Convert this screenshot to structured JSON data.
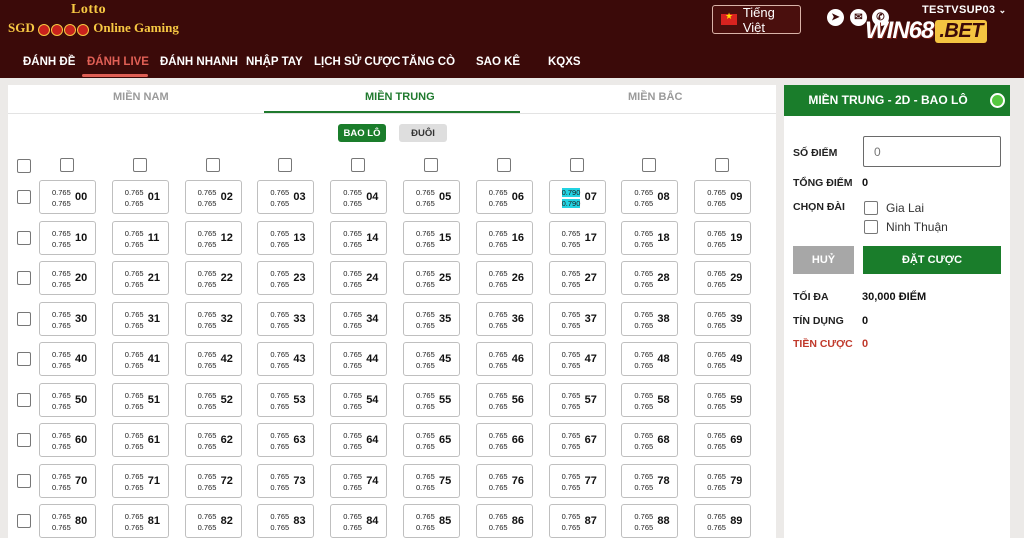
{
  "header": {
    "logo_top": "Lotto",
    "logo_prefix": "SGD",
    "logo_suffix": "Online Gaming",
    "language": "Tiếng Việt",
    "username": "TESTVSUP03",
    "brand_main": "WIN68",
    "brand_tld": ".BET",
    "icons": [
      "telegram-icon",
      "messenger-icon",
      "phone-icon"
    ]
  },
  "nav": {
    "items": [
      "ĐÁNH ĐỀ",
      "ĐÁNH LIVE",
      "ĐÁNH NHANH",
      "NHẬP TAY",
      "LỊCH SỬ CƯỢC",
      "TĂNG CÒ",
      "SAO KÊ",
      "KQXS"
    ],
    "active_index": 1
  },
  "regions": {
    "tabs": [
      "MIỀN NAM",
      "MIỀN TRUNG",
      "MIỀN BẮC"
    ],
    "active_index": 1
  },
  "modes": {
    "on_label": "BAO LÔ",
    "off_label": "ĐUÔI"
  },
  "grid": {
    "default_rate": "0.765",
    "highlight_rate": "0.790",
    "highlight_numbers": [
      "07"
    ],
    "numbers": [
      [
        "00",
        "01",
        "02",
        "03",
        "04",
        "05",
        "06",
        "07",
        "08",
        "09"
      ],
      [
        "10",
        "11",
        "12",
        "13",
        "14",
        "15",
        "16",
        "17",
        "18",
        "19"
      ],
      [
        "20",
        "21",
        "22",
        "23",
        "24",
        "25",
        "26",
        "27",
        "28",
        "29"
      ],
      [
        "30",
        "31",
        "32",
        "33",
        "34",
        "35",
        "36",
        "37",
        "38",
        "39"
      ],
      [
        "40",
        "41",
        "42",
        "43",
        "44",
        "45",
        "46",
        "47",
        "48",
        "49"
      ],
      [
        "50",
        "51",
        "52",
        "53",
        "54",
        "55",
        "56",
        "57",
        "58",
        "59"
      ],
      [
        "60",
        "61",
        "62",
        "63",
        "64",
        "65",
        "66",
        "67",
        "68",
        "69"
      ],
      [
        "70",
        "71",
        "72",
        "73",
        "74",
        "75",
        "76",
        "77",
        "78",
        "79"
      ],
      [
        "80",
        "81",
        "82",
        "83",
        "84",
        "85",
        "86",
        "87",
        "88",
        "89"
      ]
    ]
  },
  "panel": {
    "title": "MIỀN TRUNG - 2D - BAO LÔ",
    "so_diem_label": "SỐ ĐIỂM",
    "so_diem_placeholder": "0",
    "tong_diem_label": "TỔNG ĐIỂM",
    "tong_diem_value": "0",
    "chon_dai_label": "CHỌN ĐÀI",
    "stations": [
      "Gia Lai",
      "Ninh Thuận"
    ],
    "cancel_label": "HUỶ",
    "bet_label": "ĐẶT CƯỢC",
    "toi_da_label": "TỐI ĐA",
    "toi_da_value": "30,000 ĐIỂM",
    "tin_dung_label": "TÍN DỤNG",
    "tin_dung_value": "0",
    "tien_cuoc_label": "TIỀN CƯỢC",
    "tien_cuoc_value": "0"
  }
}
